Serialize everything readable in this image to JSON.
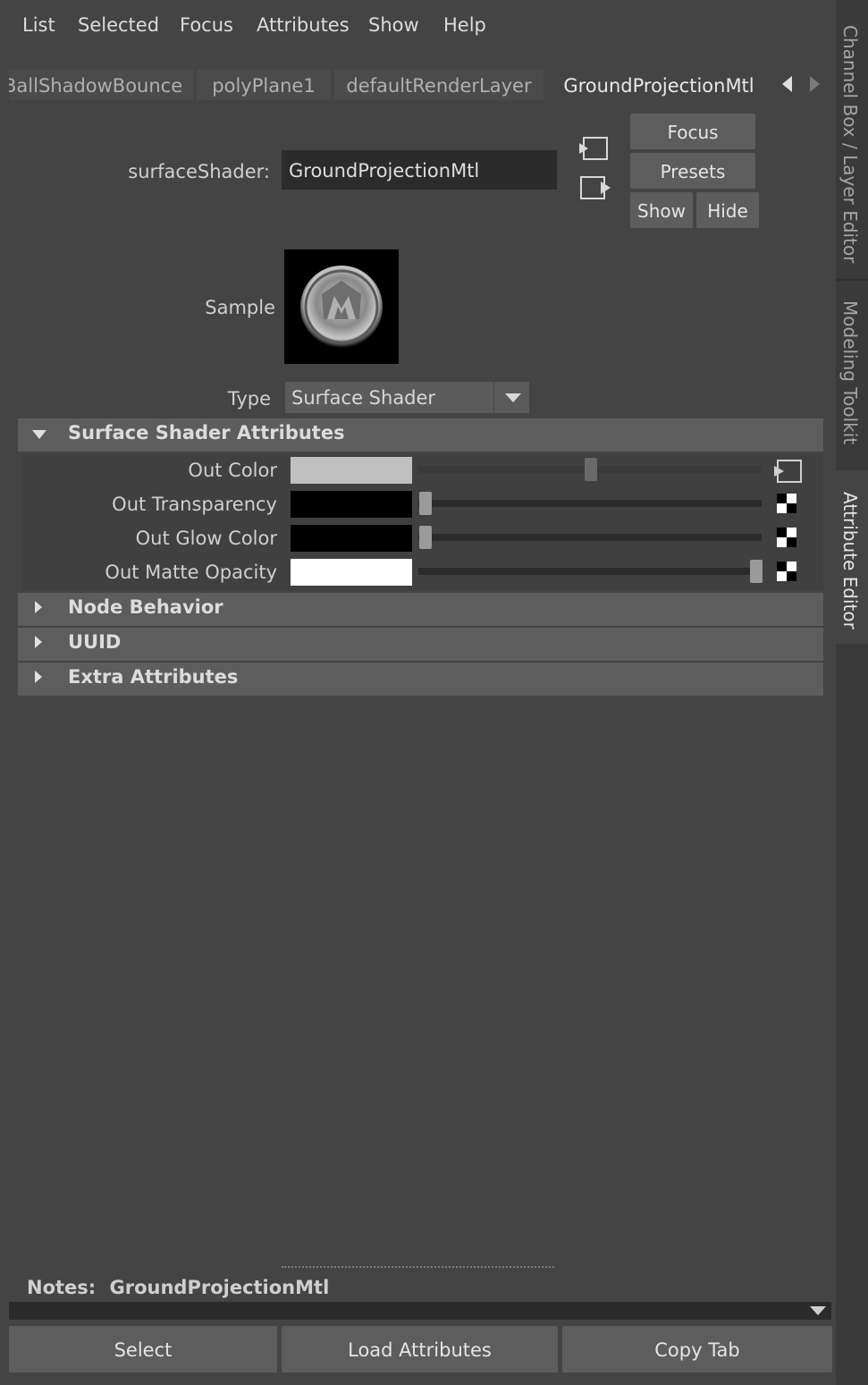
{
  "menu": [
    "List",
    "Selected",
    "Focus",
    "Attributes",
    "Show",
    "Help"
  ],
  "tabs": [
    "BallShadowBounce",
    "polyPlane1",
    "defaultRenderLayer",
    "GroundProjectionMtl"
  ],
  "side_tabs": [
    "Channel Box / Layer Editor",
    "Modeling Toolkit",
    "Attribute Editor"
  ],
  "header": {
    "node_type_label": "surfaceShader:",
    "node_name": "GroundProjectionMtl",
    "focus_button": "Focus",
    "presets_button": "Presets",
    "show_button": "Show",
    "hide_button": "Hide"
  },
  "sample_label": "Sample",
  "type": {
    "label": "Type",
    "value": "Surface Shader"
  },
  "sections": {
    "surface_shader_attributes": "Surface Shader Attributes",
    "node_behavior": "Node Behavior",
    "uuid": "UUID",
    "extra_attributes": "Extra Attributes"
  },
  "attributes": [
    {
      "label": "Out Color",
      "color": "#c0c0c0",
      "slider_fraction": 0.5
    },
    {
      "label": "Out Transparency",
      "color": "#000000",
      "slider_fraction": 0.0
    },
    {
      "label": "Out Glow Color",
      "color": "#000000",
      "slider_fraction": 0.0
    },
    {
      "label": "Out Matte Opacity",
      "color": "#ffffff",
      "slider_fraction": 1.0
    }
  ],
  "notes": {
    "label": "Notes:",
    "value": "GroundProjectionMtl"
  },
  "bottom_buttons": {
    "select": "Select",
    "load_attributes": "Load Attributes",
    "copy_tab": "Copy Tab"
  }
}
